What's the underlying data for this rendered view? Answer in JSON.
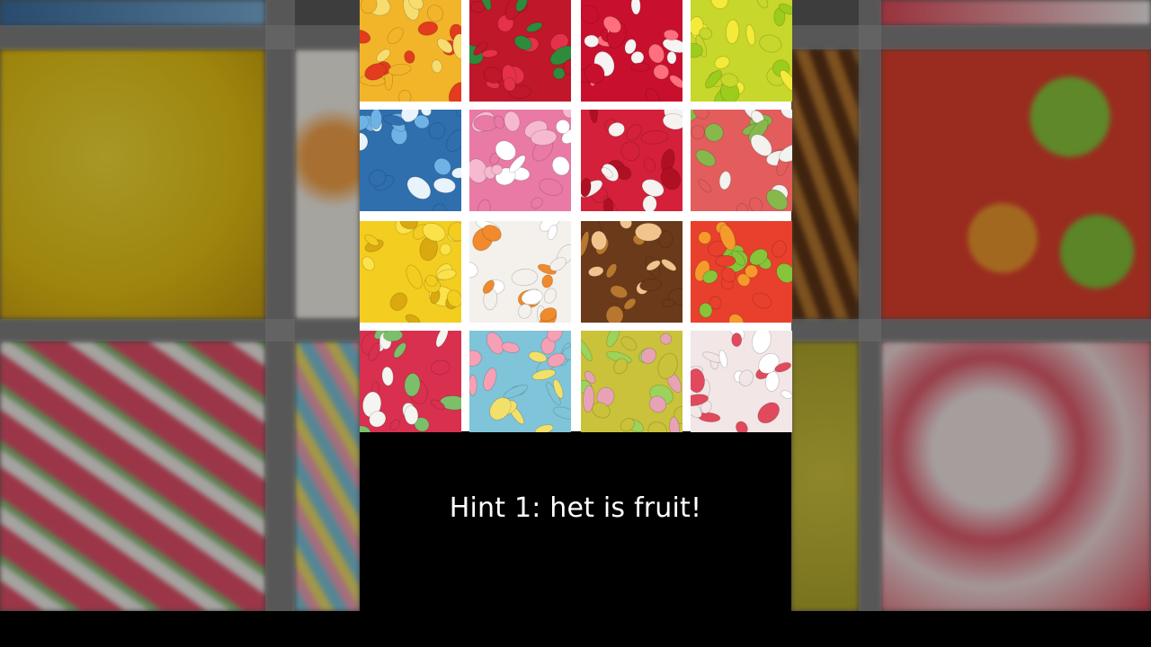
{
  "subtitle": {
    "text": "Hint 1: het is fruit!"
  },
  "grid": {
    "tiles": [
      {
        "icon": "pizza-gummies",
        "base": "#f2b52a",
        "accent": "#e23b1d",
        "accent2": "#f7dc6f"
      },
      {
        "icon": "strawberry-gummies",
        "base": "#c0172a",
        "accent": "#e6314a",
        "accent2": "#2e8b3c"
      },
      {
        "icon": "heart-gummies",
        "base": "#c8102e",
        "accent": "#f7f3f3",
        "accent2": "#ff6f7d"
      },
      {
        "icon": "apple-gummies",
        "base": "#c7d72b",
        "accent": "#f3ea3a",
        "accent2": "#9ccd1c"
      },
      {
        "icon": "blue-sour-bricks",
        "base": "#2f6fae",
        "accent": "#6fb3e6",
        "accent2": "#e9f3fb"
      },
      {
        "icon": "pink-foam-mushrooms",
        "base": "#e97aa6",
        "accent": "#f6b9cf",
        "accent2": "#ffffff"
      },
      {
        "icon": "red-white-cables",
        "base": "#d4203a",
        "accent": "#f6f2f0",
        "accent2": "#b01024"
      },
      {
        "icon": "watermelon-slices-mini",
        "base": "#e35d5d",
        "accent": "#f2f2ef",
        "accent2": "#86b84c"
      },
      {
        "icon": "banana-gummies",
        "base": "#f3cd1f",
        "accent": "#fbe24a",
        "accent2": "#d9a90f"
      },
      {
        "icon": "fried-egg-gummies",
        "base": "#f4f1ec",
        "accent": "#f08a2c",
        "accent2": "#ffffff"
      },
      {
        "icon": "cola-worms",
        "base": "#6b3a1a",
        "accent": "#b7772e",
        "accent2": "#f0c48c"
      },
      {
        "icon": "fruit-gums-mix",
        "base": "#e8402c",
        "accent": "#86c43a",
        "accent2": "#f59a2b"
      },
      {
        "icon": "watermelon-slices",
        "base": "#d9304f",
        "accent": "#f4f4f0",
        "accent2": "#7cbf6a"
      },
      {
        "icon": "sour-worms",
        "base": "#7fc4d8",
        "accent": "#f5a0b5",
        "accent2": "#f3e06a"
      },
      {
        "icon": "sour-bunnies",
        "base": "#c9c23a",
        "accent": "#e8a2b6",
        "accent2": "#9cd35a"
      },
      {
        "icon": "strawberry-marshmallow",
        "base": "#f2e6e6",
        "accent": "#e04a5c",
        "accent2": "#ffffff"
      }
    ]
  }
}
